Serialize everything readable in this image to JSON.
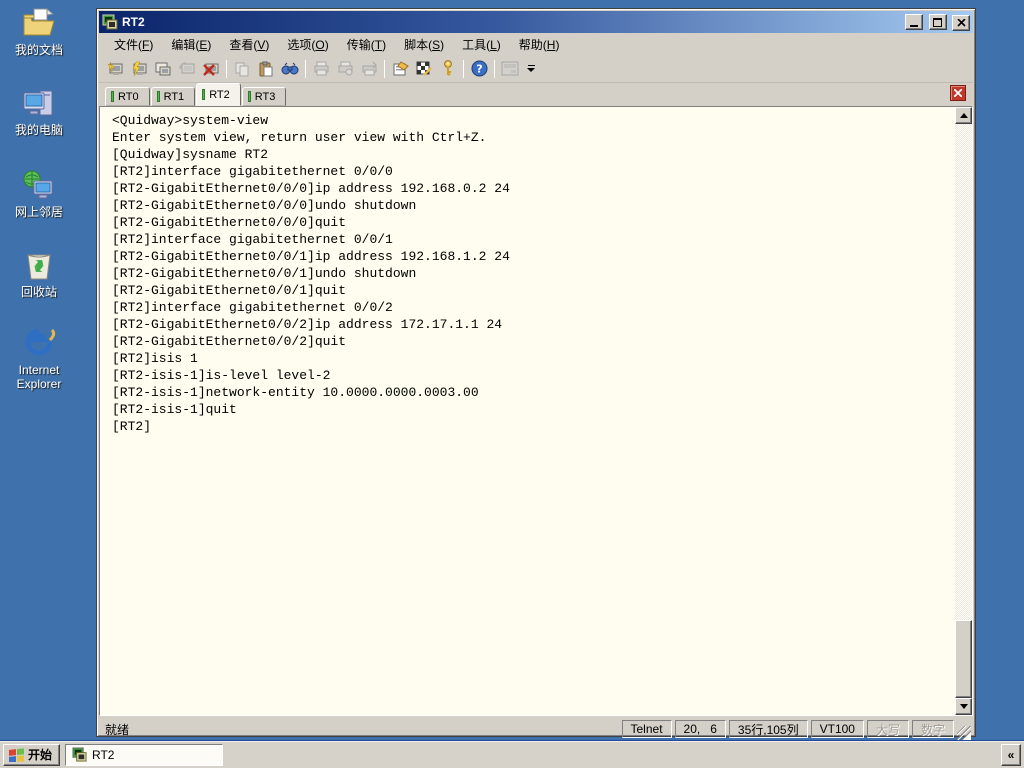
{
  "colors": {
    "desktop_background": "#3F72AC",
    "titlebar_left": "#0A246A",
    "titlebar_right": "#A6CAF0",
    "chrome_gray": "#D4D0C8",
    "terminal_background": "#FEFDEF",
    "terminal_text": "#000000",
    "tab_indicator_green": "#4CB648",
    "tab_close_red": "#C0392B"
  },
  "desktop": {
    "icons": [
      {
        "label": "我的文档"
      },
      {
        "label": "我的电脑"
      },
      {
        "label": "网上邻居"
      },
      {
        "label": "回收站"
      },
      {
        "label": "Internet\nExplorer"
      }
    ]
  },
  "window": {
    "title": "RT2",
    "menu": {
      "items": [
        {
          "pre": "文件(",
          "key": "F",
          "post": ")"
        },
        {
          "pre": "编辑(",
          "key": "E",
          "post": ")"
        },
        {
          "pre": "查看(",
          "key": "V",
          "post": ")"
        },
        {
          "pre": "选项(",
          "key": "O",
          "post": ")"
        },
        {
          "pre": "传输(",
          "key": "T",
          "post": ")"
        },
        {
          "pre": "脚本(",
          "key": "S",
          "post": ")"
        },
        {
          "pre": "工具(",
          "key": "L",
          "post": ")"
        },
        {
          "pre": "帮助(",
          "key": "H",
          "post": ")"
        }
      ]
    },
    "toolbar": {
      "icons": [
        "quick-connect-icon",
        "connect-icon",
        "connect-in-tab-icon",
        "reconnect-icon",
        "disconnect-icon",
        "copy-icon",
        "paste-icon",
        "find-icon",
        "print-icon",
        "print-preview-icon",
        "print-setup-icon",
        "session-options-icon",
        "keymap-icon",
        "key-agent-icon",
        "help-icon",
        "connect-bar-icon",
        "toolbar-overflow-icon"
      ]
    },
    "tabs": [
      {
        "label": "RT0",
        "active": false
      },
      {
        "label": "RT1",
        "active": false
      },
      {
        "label": "RT2",
        "active": true
      },
      {
        "label": "RT3",
        "active": false
      }
    ],
    "terminal": {
      "lines": [
        "<Quidway>system-view",
        "Enter system view, return user view with Ctrl+Z.",
        "[Quidway]sysname RT2",
        "[RT2]interface gigabitethernet 0/0/0",
        "[RT2-GigabitEthernet0/0/0]ip address 192.168.0.2 24",
        "[RT2-GigabitEthernet0/0/0]undo shutdown",
        "[RT2-GigabitEthernet0/0/0]quit",
        "[RT2]interface gigabitethernet 0/0/1",
        "[RT2-GigabitEthernet0/0/1]ip address 192.168.1.2 24",
        "[RT2-GigabitEthernet0/0/1]undo shutdown",
        "[RT2-GigabitEthernet0/0/1]quit",
        "[RT2]interface gigabitethernet 0/0/2",
        "[RT2-GigabitEthernet0/0/2]ip address 172.17.1.1 24",
        "[RT2-GigabitEthernet0/0/2]quit",
        "[RT2]isis 1",
        "[RT2-isis-1]is-level level-2",
        "[RT2-isis-1]network-entity 10.0000.0000.0003.00",
        "[RT2-isis-1]quit",
        "[RT2]"
      ]
    },
    "statusbar": {
      "ready": "就绪",
      "protocol": "Telnet",
      "cursor_position": "20,   6",
      "screen_size": "35行,105列",
      "emulation": "VT100",
      "caps_lock": "大写",
      "num_lock": "数字"
    }
  },
  "taskbar": {
    "start_label": "开始",
    "tasks": [
      {
        "label": "RT2"
      }
    ],
    "collapse_chevron": "«"
  }
}
